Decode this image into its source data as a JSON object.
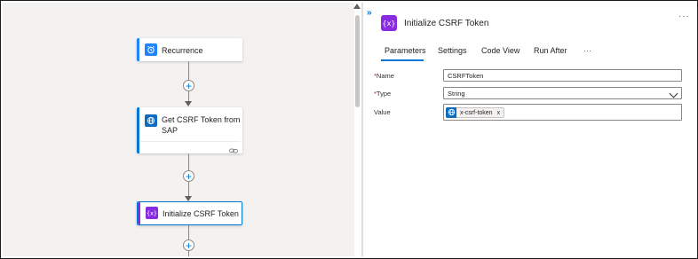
{
  "canvas": {
    "cards": {
      "recurrence": {
        "title": "Recurrence",
        "accent": "#1f85ff",
        "icon": "alarm-clock-icon"
      },
      "get_csrf": {
        "title_line1": "Get CSRF Token from",
        "title_line2": "SAP",
        "accent": "#0078d4",
        "icon": "globe-icon",
        "footer_icon": "link-icon"
      },
      "init_csrf": {
        "title": "Initialize CSRF Token",
        "accent": "#8a2be2",
        "icon": "variable-icon",
        "selected": true
      }
    },
    "add_symbol": "+"
  },
  "panel": {
    "expand_symbol": "»",
    "title": "Initialize CSRF Token",
    "more": "···",
    "icon": "variable-icon",
    "icon_color": "#8a2be2",
    "tabs": [
      {
        "label": "Parameters",
        "active": true
      },
      {
        "label": "Settings"
      },
      {
        "label": "Code View"
      },
      {
        "label": "Run After"
      },
      {
        "label": "···"
      }
    ],
    "fields": {
      "name": {
        "label": "Name",
        "required_mark": "*",
        "value": "CSRFToken"
      },
      "type": {
        "label": "Type",
        "required_mark": "*",
        "value": "String"
      },
      "value": {
        "label": "Value",
        "token": "x-csrf-token",
        "token_remove": "x",
        "token_icon": "globe-icon"
      }
    }
  }
}
